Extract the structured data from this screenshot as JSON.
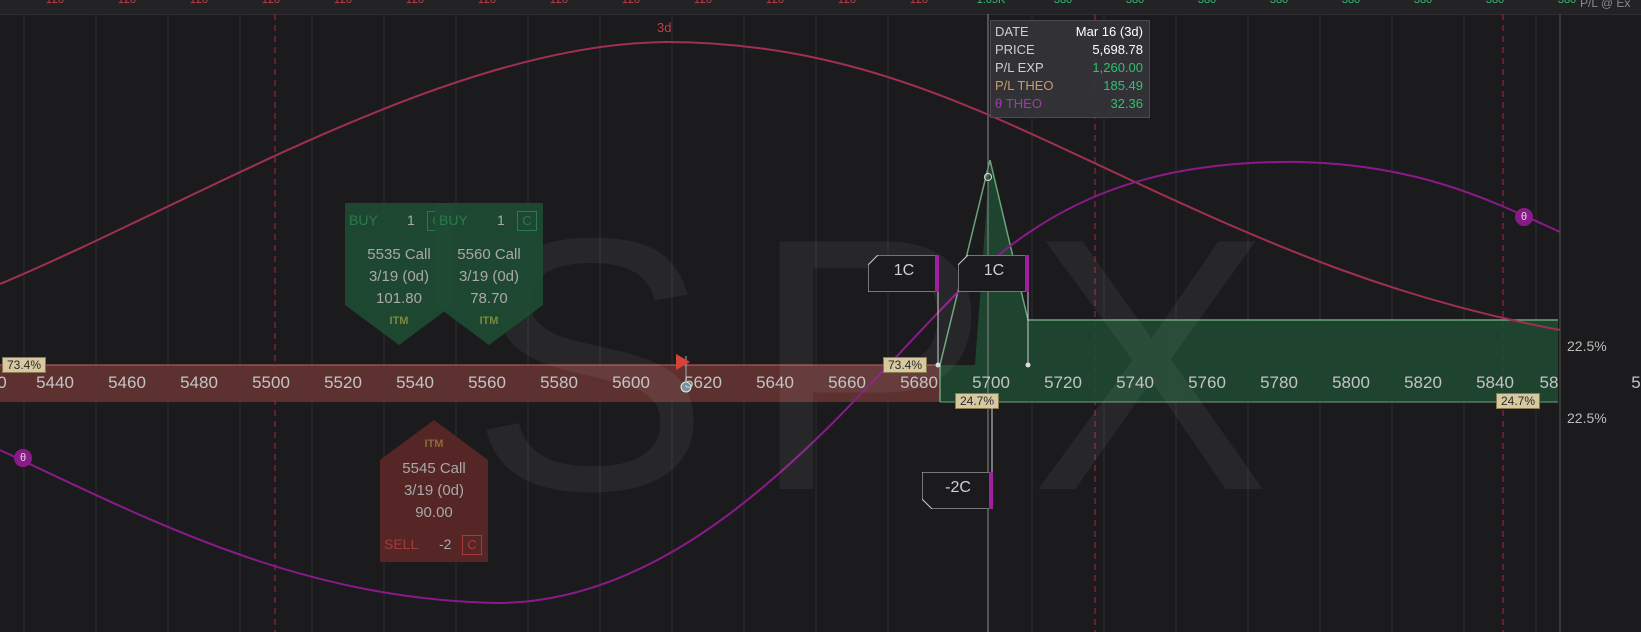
{
  "header": {
    "top_labels": [
      "120",
      "120",
      "120",
      "120",
      "120",
      "120",
      "120",
      "120",
      "120",
      "120",
      "120",
      "120",
      "120",
      "1.65K",
      "380",
      "380",
      "380",
      "380",
      "380",
      "380",
      "380",
      "380"
    ],
    "corner": "P/L @ Ex"
  },
  "watermark": "SPX",
  "expiry_marker": "3d",
  "strike_axis": {
    "ticks": [
      "5440",
      "5460",
      "5480",
      "5500",
      "5520",
      "5540",
      "5560",
      "5580",
      "5600",
      "5620",
      "5640",
      "5660",
      "5680",
      "5700",
      "5720",
      "5740",
      "5760",
      "5780",
      "5800",
      "5820",
      "5840"
    ],
    "left_cut_tick": "0",
    "right_cut_tick": "58",
    "far_right_cut": "5"
  },
  "prob_badges": {
    "left_outer": "73.4%",
    "left_inner": "73.4%",
    "right_inner": "24.7%",
    "right_outer": "24.7%"
  },
  "vol_labels": {
    "upper": "22.5%",
    "lower": "22.5%"
  },
  "theta_marker": "θ",
  "tooltip": {
    "rows": [
      {
        "label": "DATE",
        "value": "Mar 16 (3d)",
        "label_color": "#cfcfcf",
        "value_color": "#ffffff"
      },
      {
        "label": "PRICE",
        "value": "5,698.78",
        "label_color": "#cfcfcf",
        "value_color": "#ffffff"
      },
      {
        "label": "P/L EXP",
        "value": "1,260.00",
        "label_color": "#cfcfcf",
        "value_color": "#2fbf71"
      },
      {
        "label": "P/L THEO",
        "value": "185.49",
        "label_color": "#c99a6a",
        "value_color": "#2fbf71"
      },
      {
        "label": "θ THEO",
        "value": "32.36",
        "label_color": "#9a3da6",
        "value_color": "#2fbf71"
      }
    ]
  },
  "legs": {
    "buy1": {
      "side": "BUY",
      "qty": "1",
      "type_tag": "C",
      "desc": "5535 Call",
      "date": "3/19 (0d)",
      "price": "101.80",
      "itm": "ITM"
    },
    "buy2": {
      "side": "BUY",
      "qty": "1",
      "type_tag": "C",
      "desc": "5560 Call",
      "date": "3/19 (0d)",
      "price": "78.70",
      "itm": "ITM"
    },
    "sell": {
      "side": "SELL",
      "qty": "-2",
      "type_tag": "C",
      "desc": "5545 Call",
      "date": "3/19 (0d)",
      "price": "90.00",
      "itm": "ITM"
    }
  },
  "qty_boxes": {
    "a": "1C",
    "b": "1C",
    "c": "-2C"
  },
  "colors": {
    "background": "#1b1b1d",
    "pl_theo_curve": "#a03050",
    "theta_curve": "#8a1a8a",
    "profit_fill": "#1f4a33",
    "loss_fill": "#6a3535",
    "accent_red": "#c83a4a"
  }
}
